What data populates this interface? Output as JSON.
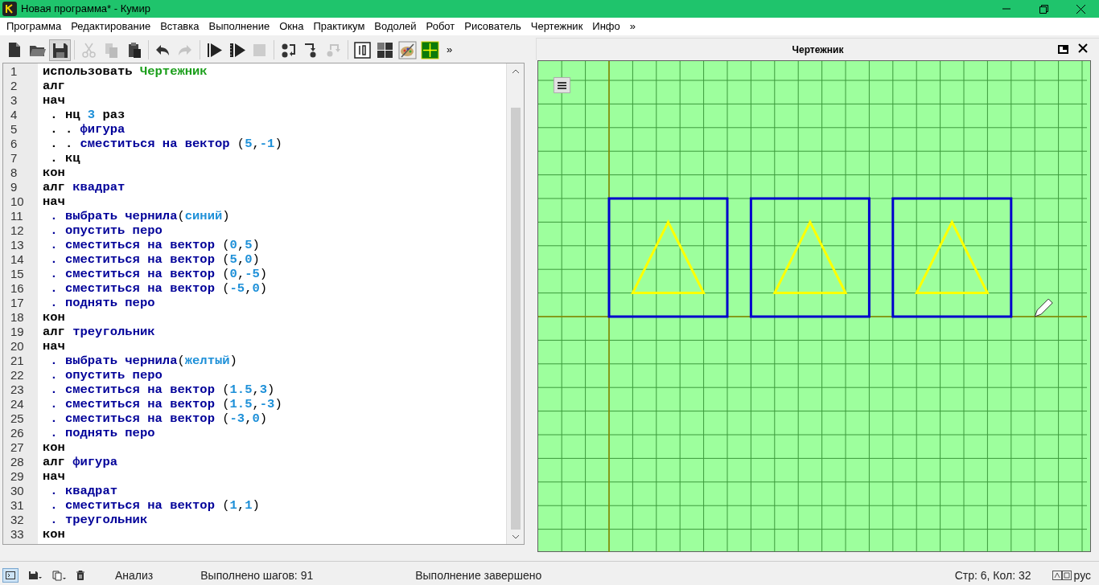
{
  "window": {
    "title": "Новая программа* - Кумир"
  },
  "menu": [
    "Программа",
    "Редактирование",
    "Вставка",
    "Выполнение",
    "Окна",
    "Практикум",
    "Водолей",
    "Робот",
    "Рисователь",
    "Чертежник",
    "Инфо",
    "»"
  ],
  "toolbar": [
    {
      "kind": "new",
      "disabled": false
    },
    {
      "kind": "open",
      "disabled": false
    },
    {
      "kind": "save",
      "disabled": false
    },
    {
      "kind": "sep"
    },
    {
      "kind": "cut",
      "disabled": true
    },
    {
      "kind": "copy",
      "disabled": true
    },
    {
      "kind": "paste",
      "disabled": false
    },
    {
      "kind": "sep"
    },
    {
      "kind": "undo",
      "disabled": false
    },
    {
      "kind": "redo",
      "disabled": true
    },
    {
      "kind": "sep"
    },
    {
      "kind": "run",
      "disabled": false
    },
    {
      "kind": "steprun",
      "disabled": false
    },
    {
      "kind": "stop",
      "disabled": true
    },
    {
      "kind": "sep"
    },
    {
      "kind": "stepover",
      "disabled": false
    },
    {
      "kind": "stepin",
      "disabled": false
    },
    {
      "kind": "stepout",
      "disabled": true
    },
    {
      "kind": "sep"
    },
    {
      "kind": "counter",
      "disabled": false
    },
    {
      "kind": "grid",
      "disabled": false
    },
    {
      "kind": "palette",
      "disabled": false
    },
    {
      "kind": "drafter",
      "disabled": false
    }
  ],
  "toolbar_more": "»",
  "editor": {
    "lines": [
      {
        "number": "1",
        "tokens": [
          {
            "kind": "keyword",
            "text": "использовать "
          },
          {
            "kind": "module",
            "text": "Чертежник"
          }
        ]
      },
      {
        "number": "2",
        "tokens": [
          {
            "kind": "keyword",
            "text": "алг"
          }
        ]
      },
      {
        "number": "3",
        "tokens": [
          {
            "kind": "keyword",
            "text": "нач"
          }
        ]
      },
      {
        "number": "4",
        "tokens": [
          {
            "kind": "keyword",
            "text": " . нц "
          },
          {
            "kind": "value",
            "text": "3"
          },
          {
            "kind": "keyword",
            "text": " раз"
          }
        ]
      },
      {
        "number": "5",
        "tokens": [
          {
            "kind": "keyword",
            "text": " . . "
          },
          {
            "kind": "call",
            "text": "фигура"
          }
        ]
      },
      {
        "number": "6",
        "tokens": [
          {
            "kind": "keyword",
            "text": " . . "
          },
          {
            "kind": "call",
            "text": "сместиться на вектор "
          },
          {
            "kind": "plain",
            "text": "("
          },
          {
            "kind": "value",
            "text": "5"
          },
          {
            "kind": "plain",
            "text": ","
          },
          {
            "kind": "value",
            "text": "-1"
          },
          {
            "kind": "plain",
            "text": ")"
          }
        ]
      },
      {
        "number": "7",
        "tokens": [
          {
            "kind": "keyword",
            "text": " . кц"
          }
        ]
      },
      {
        "number": "8",
        "tokens": [
          {
            "kind": "keyword",
            "text": "кон"
          }
        ]
      },
      {
        "number": "9",
        "tokens": [
          {
            "kind": "keyword",
            "text": "алг "
          },
          {
            "kind": "call",
            "text": "квадрат"
          }
        ]
      },
      {
        "number": "10",
        "tokens": [
          {
            "kind": "keyword",
            "text": "нач"
          }
        ]
      },
      {
        "number": "11",
        "tokens": [
          {
            "kind": "call",
            "text": " . выбрать чернила"
          },
          {
            "kind": "plain",
            "text": "("
          },
          {
            "kind": "value",
            "text": "синий"
          },
          {
            "kind": "plain",
            "text": ")"
          }
        ]
      },
      {
        "number": "12",
        "tokens": [
          {
            "kind": "call",
            "text": " . опустить перо"
          }
        ]
      },
      {
        "number": "13",
        "tokens": [
          {
            "kind": "call",
            "text": " . сместиться на вектор "
          },
          {
            "kind": "plain",
            "text": "("
          },
          {
            "kind": "value",
            "text": "0"
          },
          {
            "kind": "plain",
            "text": ","
          },
          {
            "kind": "value",
            "text": "5"
          },
          {
            "kind": "plain",
            "text": ")"
          }
        ]
      },
      {
        "number": "14",
        "tokens": [
          {
            "kind": "call",
            "text": " . сместиться на вектор "
          },
          {
            "kind": "plain",
            "text": "("
          },
          {
            "kind": "value",
            "text": "5"
          },
          {
            "kind": "plain",
            "text": ","
          },
          {
            "kind": "value",
            "text": "0"
          },
          {
            "kind": "plain",
            "text": ")"
          }
        ]
      },
      {
        "number": "15",
        "tokens": [
          {
            "kind": "call",
            "text": " . сместиться на вектор "
          },
          {
            "kind": "plain",
            "text": "("
          },
          {
            "kind": "value",
            "text": "0"
          },
          {
            "kind": "plain",
            "text": ","
          },
          {
            "kind": "value",
            "text": "-5"
          },
          {
            "kind": "plain",
            "text": ")"
          }
        ]
      },
      {
        "number": "16",
        "tokens": [
          {
            "kind": "call",
            "text": " . сместиться на вектор "
          },
          {
            "kind": "plain",
            "text": "("
          },
          {
            "kind": "value",
            "text": "-5"
          },
          {
            "kind": "plain",
            "text": ","
          },
          {
            "kind": "value",
            "text": "0"
          },
          {
            "kind": "plain",
            "text": ")"
          }
        ]
      },
      {
        "number": "17",
        "tokens": [
          {
            "kind": "call",
            "text": " . поднять перо"
          }
        ]
      },
      {
        "number": "18",
        "tokens": [
          {
            "kind": "keyword",
            "text": "кон"
          }
        ]
      },
      {
        "number": "19",
        "tokens": [
          {
            "kind": "keyword",
            "text": "алг "
          },
          {
            "kind": "call",
            "text": "треугольник"
          }
        ]
      },
      {
        "number": "20",
        "tokens": [
          {
            "kind": "keyword",
            "text": "нач"
          }
        ]
      },
      {
        "number": "21",
        "tokens": [
          {
            "kind": "call",
            "text": " . выбрать чернила"
          },
          {
            "kind": "plain",
            "text": "("
          },
          {
            "kind": "value",
            "text": "желтый"
          },
          {
            "kind": "plain",
            "text": ")"
          }
        ]
      },
      {
        "number": "22",
        "tokens": [
          {
            "kind": "call",
            "text": " . опустить перо"
          }
        ]
      },
      {
        "number": "23",
        "tokens": [
          {
            "kind": "call",
            "text": " . сместиться на вектор "
          },
          {
            "kind": "plain",
            "text": "("
          },
          {
            "kind": "value",
            "text": "1.5"
          },
          {
            "kind": "plain",
            "text": ","
          },
          {
            "kind": "value",
            "text": "3"
          },
          {
            "kind": "plain",
            "text": ")"
          }
        ]
      },
      {
        "number": "24",
        "tokens": [
          {
            "kind": "call",
            "text": " . сместиться на вектор "
          },
          {
            "kind": "plain",
            "text": "("
          },
          {
            "kind": "value",
            "text": "1.5"
          },
          {
            "kind": "plain",
            "text": ","
          },
          {
            "kind": "value",
            "text": "-3"
          },
          {
            "kind": "plain",
            "text": ")"
          }
        ]
      },
      {
        "number": "25",
        "tokens": [
          {
            "kind": "call",
            "text": " . сместиться на вектор "
          },
          {
            "kind": "plain",
            "text": "("
          },
          {
            "kind": "value",
            "text": "-3"
          },
          {
            "kind": "plain",
            "text": ","
          },
          {
            "kind": "value",
            "text": "0"
          },
          {
            "kind": "plain",
            "text": ")"
          }
        ]
      },
      {
        "number": "26",
        "tokens": [
          {
            "kind": "call",
            "text": " . поднять перо"
          }
        ]
      },
      {
        "number": "27",
        "tokens": [
          {
            "kind": "keyword",
            "text": "кон"
          }
        ]
      },
      {
        "number": "28",
        "tokens": [
          {
            "kind": "keyword",
            "text": "алг "
          },
          {
            "kind": "call",
            "text": "фигура"
          }
        ]
      },
      {
        "number": "29",
        "tokens": [
          {
            "kind": "keyword",
            "text": "нач"
          }
        ]
      },
      {
        "number": "30",
        "tokens": [
          {
            "kind": "call",
            "text": " . квадрат"
          }
        ]
      },
      {
        "number": "31",
        "tokens": [
          {
            "kind": "call",
            "text": " . сместиться на вектор "
          },
          {
            "kind": "plain",
            "text": "("
          },
          {
            "kind": "value",
            "text": "1"
          },
          {
            "kind": "plain",
            "text": ","
          },
          {
            "kind": "value",
            "text": "1"
          },
          {
            "kind": "plain",
            "text": ")"
          }
        ]
      },
      {
        "number": "32",
        "tokens": [
          {
            "kind": "call",
            "text": " . треугольник"
          }
        ]
      },
      {
        "number": "33",
        "tokens": [
          {
            "kind": "keyword",
            "text": "кон"
          }
        ]
      }
    ]
  },
  "drafter": {
    "title": "Чертежник"
  },
  "status_bar": {
    "mode": "Анализ",
    "steps": "Выполнено шагов: 91",
    "message": "Выполнение завершено",
    "position": "Стр: 6, Кол: 32",
    "language": "рус"
  }
}
